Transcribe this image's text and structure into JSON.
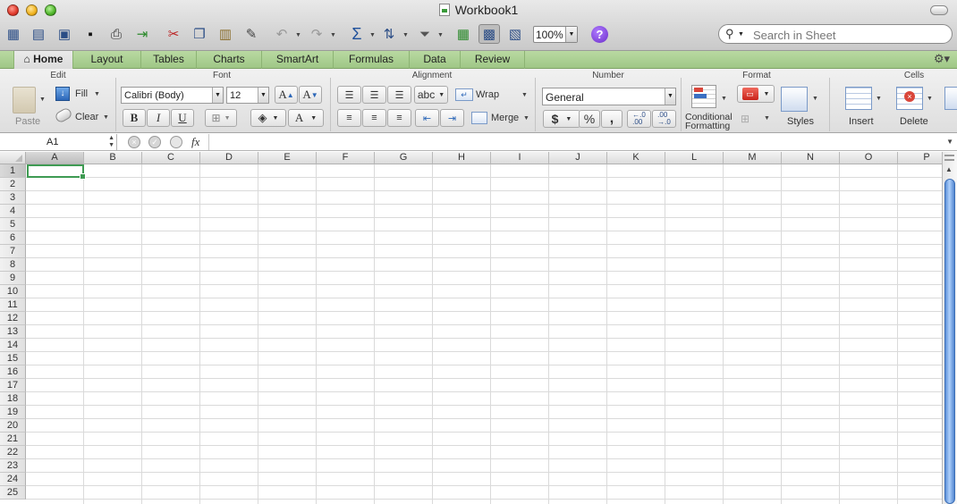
{
  "window": {
    "title": "Workbook1"
  },
  "toolbar": {
    "zoom": "100%",
    "search_placeholder": "Search in Sheet",
    "icons": [
      "new-sheet-icon",
      "templates-icon",
      "open-icon",
      "save-icon",
      "print-icon",
      "import-icon",
      "cut-icon",
      "copy-icon",
      "paste-icon",
      "format-painter-icon",
      "undo-icon",
      "redo-icon",
      "autosum-icon",
      "sort-icon",
      "filter-icon",
      "gallery-icon",
      "toolbox-icon",
      "media-icon",
      "help-icon"
    ]
  },
  "ribbon_tabs": [
    "Home",
    "Layout",
    "Tables",
    "Charts",
    "SmartArt",
    "Formulas",
    "Data",
    "Review"
  ],
  "ribbon": {
    "groups": {
      "edit": "Edit",
      "font": "Font",
      "alignment": "Alignment",
      "number": "Number",
      "format": "Format",
      "cells": "Cells"
    },
    "edit": {
      "paste": "Paste",
      "fill": "Fill",
      "clear": "Clear"
    },
    "font": {
      "name": "Calibri (Body)",
      "size": "12",
      "bold": "B",
      "italic": "I",
      "underline": "U",
      "grow": "A",
      "shrink": "A",
      "color": "A"
    },
    "alignment": {
      "orientation": "abc",
      "wrap": "Wrap",
      "merge": "Merge"
    },
    "number": {
      "format": "General",
      "currency": "$",
      "percent": "%",
      "comma": ",",
      "inc_decimal": "←.0\n.00",
      "dec_decimal": ".00\n→.0"
    },
    "format": {
      "conditional_line1": "Conditional",
      "conditional_line2": "Formatting",
      "styles": "Styles"
    },
    "cells": {
      "insert": "Insert",
      "delete": "Delete"
    }
  },
  "formula_bar": {
    "name_box": "A1",
    "fx": "fx",
    "value": ""
  },
  "sheet": {
    "columns": [
      "A",
      "B",
      "C",
      "D",
      "E",
      "F",
      "G",
      "H",
      "I",
      "J",
      "K",
      "L",
      "M",
      "N",
      "O",
      "P"
    ],
    "rows": [
      "1",
      "2",
      "3",
      "4",
      "5",
      "6",
      "7",
      "8",
      "9",
      "10",
      "11",
      "12",
      "13",
      "14",
      "15",
      "16",
      "17",
      "18",
      "19",
      "20",
      "21",
      "22",
      "23",
      "24",
      "25"
    ],
    "active_cell": "A1"
  },
  "colors": {
    "ribbon_tab_green": "#a8ce90",
    "selection_green": "#3f9b53",
    "scroll_blue": "#5b8fd8"
  }
}
